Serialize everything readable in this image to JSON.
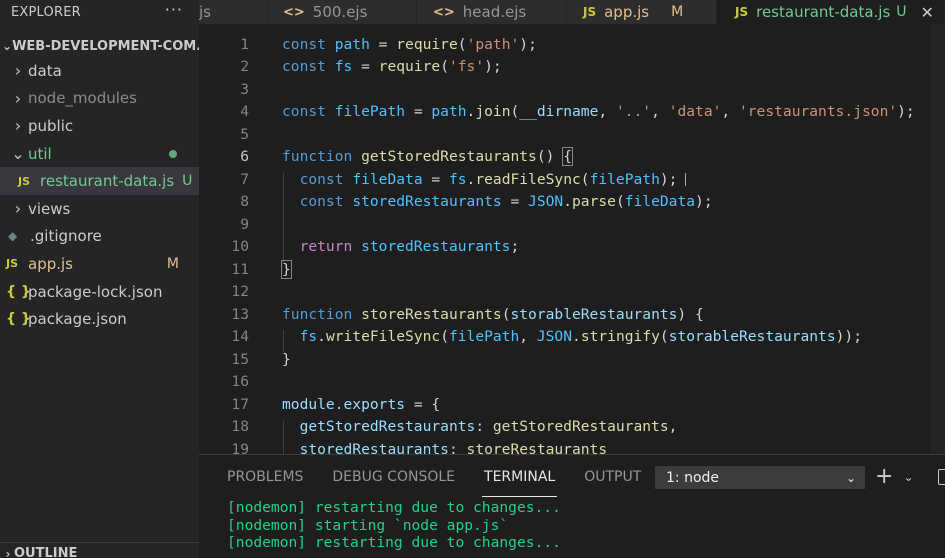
{
  "sidebar": {
    "title": "EXPLORER",
    "more": "···",
    "workspace": "WEB-DEVELOPMENT-COM...",
    "items": [
      {
        "label": "data"
      },
      {
        "label": "node_modules"
      },
      {
        "label": "public"
      },
      {
        "label": "util"
      },
      {
        "label": "restaurant-data.js",
        "icon": "JS",
        "badge": "U"
      },
      {
        "label": "views"
      },
      {
        "label": ".gitignore",
        "icon": "◆"
      },
      {
        "label": "app.js",
        "icon": "JS",
        "badge": "M"
      },
      {
        "label": "package-lock.json",
        "icon": "{ }"
      },
      {
        "label": "package.json",
        "icon": "{ }"
      }
    ],
    "outline": "OUTLINE"
  },
  "tabs": [
    {
      "label": "js"
    },
    {
      "label": "500.ejs",
      "icon": "<>"
    },
    {
      "label": "head.ejs",
      "icon": "<>"
    },
    {
      "label": "app.js",
      "icon": "JS",
      "badge": "M"
    },
    {
      "label": "restaurant-data.js",
      "icon": "JS",
      "badge": "U",
      "close": "✕"
    }
  ],
  "editor": {
    "line_numbers": [
      "1",
      "2",
      "3",
      "4",
      "5",
      "6",
      "7",
      "8",
      "9",
      "10",
      "11",
      "12",
      "13",
      "14",
      "15",
      "16",
      "17",
      "18",
      "19"
    ],
    "tokens": {
      "const": "const",
      "function": "function",
      "return": "return",
      "path": "path",
      "fs": "fs",
      "require": "require",
      "path_str": "'path'",
      "fs_str": "'fs'",
      "filePath": "filePath",
      "join": "join",
      "dirname": "__dirname",
      "dotdot": "'..'",
      "data_str": "'data'",
      "json_str": "'restaurants.json'",
      "getStoredRestaurants": "getStoredRestaurants",
      "fileData": "fileData",
      "readFileSync": "readFileSync",
      "storedRestaurants": "storedRestaurants",
      "JSON": "JSON",
      "parse": "parse",
      "storeRestaurants": "storeRestaurants",
      "storableRestaurants": "storableRestaurants",
      "writeFileSync": "writeFileSync",
      "stringify": "stringify",
      "module": "module",
      "exports": "exports"
    }
  },
  "panel": {
    "tabs": [
      "PROBLEMS",
      "DEBUG CONSOLE",
      "TERMINAL",
      "OUTPUT"
    ],
    "terminal_select": "1: node",
    "chevron": "⌄",
    "plus": "+",
    "terminal_lines": [
      "[nodemon] restarting due to changes...",
      "[nodemon] starting `node app.js`",
      "[nodemon] restarting due to changes..."
    ]
  }
}
